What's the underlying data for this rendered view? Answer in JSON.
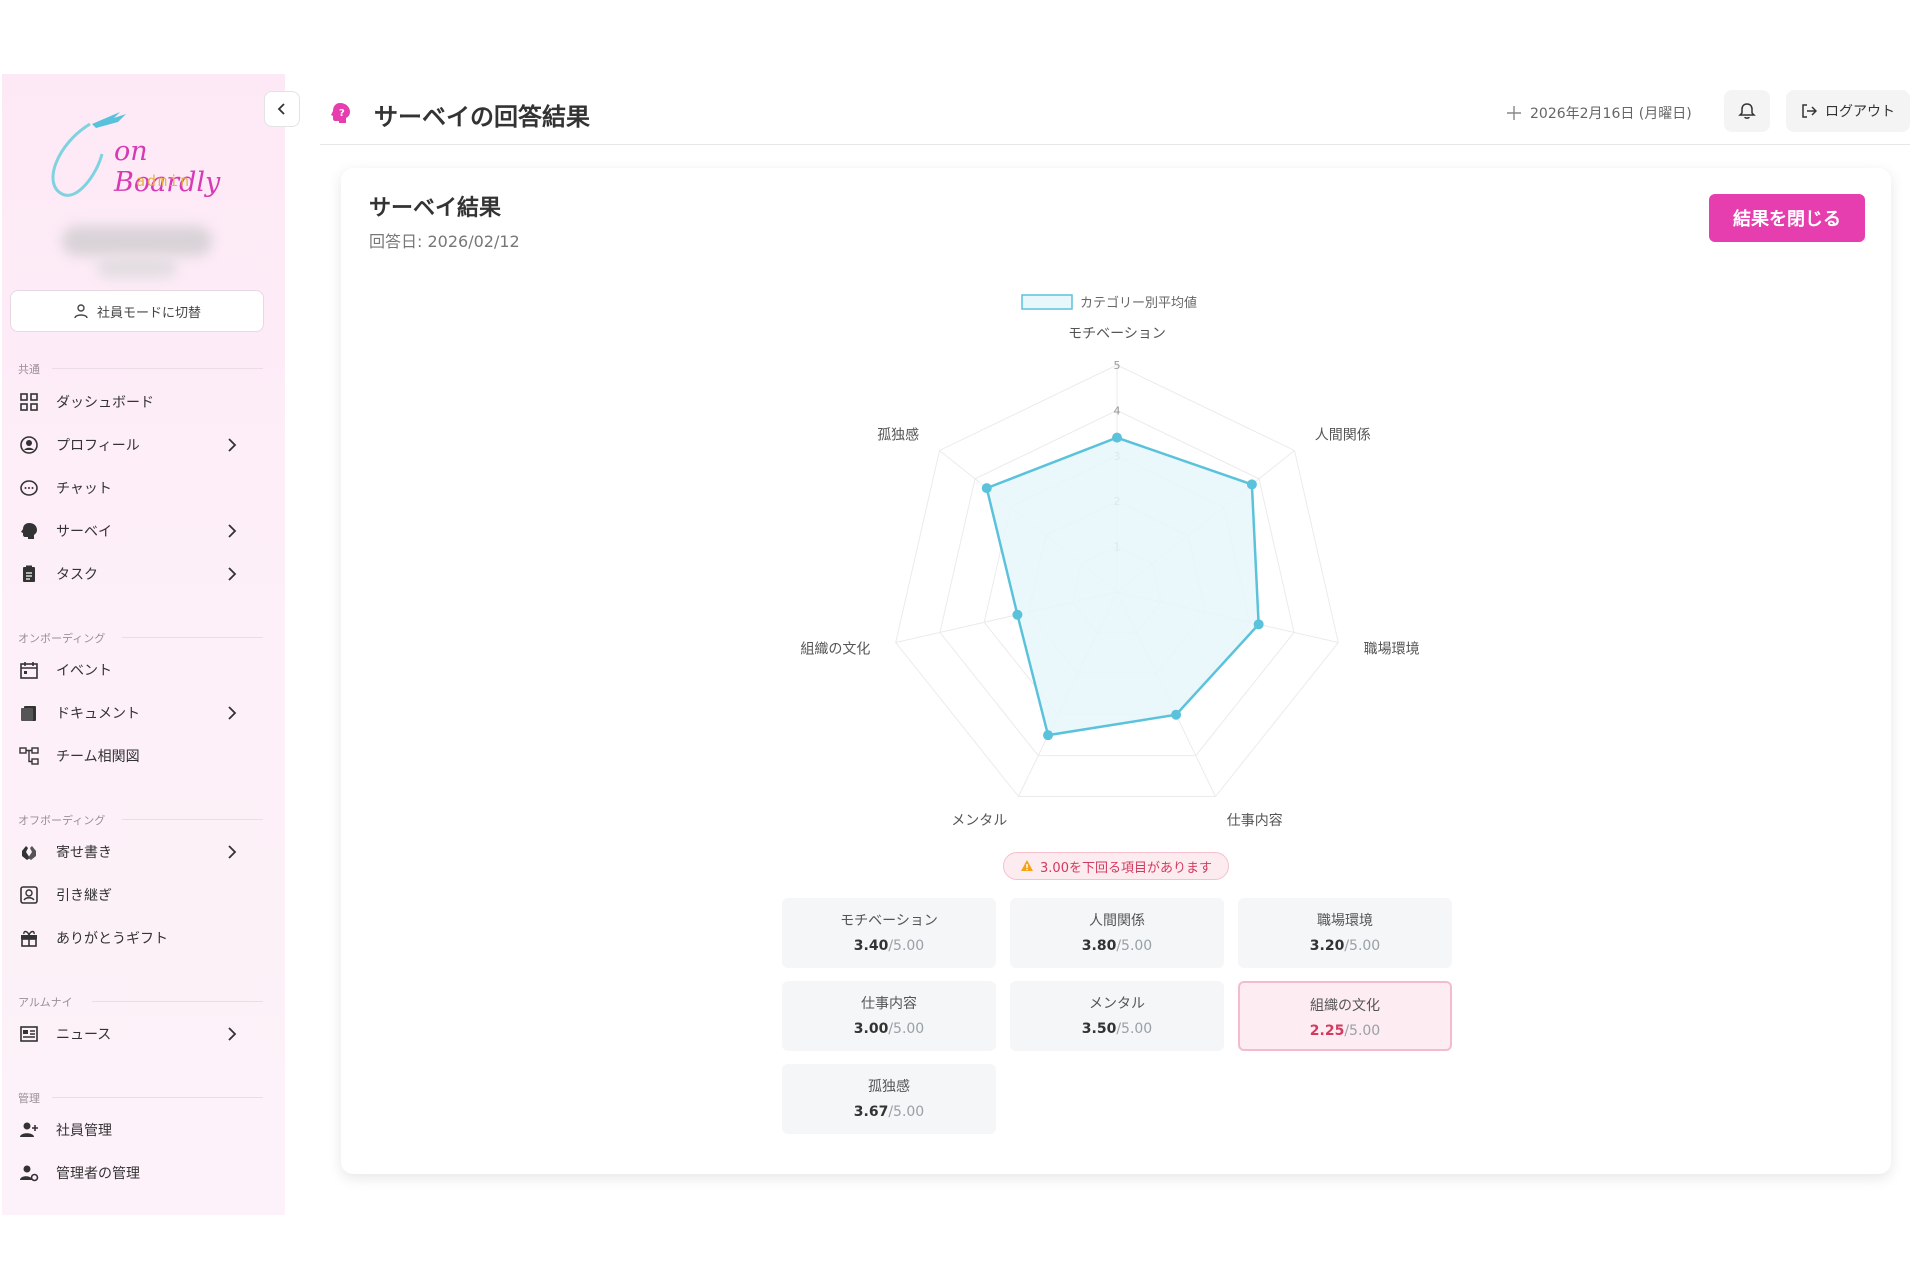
{
  "app": {
    "logo_text": "on Boardly",
    "logo_sub": "admin"
  },
  "sidebar": {
    "mode_switch": "社員モードに切替",
    "sections": [
      {
        "label": "共通",
        "items": [
          "ダッシュボード",
          "プロフィール",
          "チャット",
          "サーベイ",
          "タスク"
        ]
      },
      {
        "label": "オンボーディング",
        "items": [
          "イベント",
          "ドキュメント",
          "チーム相関図"
        ]
      },
      {
        "label": "オフボーディング",
        "items": [
          "寄せ書き",
          "引き継ぎ",
          "ありがとうギフト"
        ]
      },
      {
        "label": "アルムナイ",
        "items": [
          "ニュース"
        ]
      },
      {
        "label": "管理",
        "items": [
          "社員管理",
          "管理者の管理"
        ]
      }
    ]
  },
  "header": {
    "title": "サーベイの回答結果",
    "date": "2026年2月16日 (月曜日)",
    "logout": "ログアウト"
  },
  "card": {
    "title": "サーベイ結果",
    "answered_date": "回答日: 2026/02/12",
    "close_button": "結果を閉じる",
    "warning": "3.00を下回る項目があります",
    "categories": [
      {
        "name": "モチベーション",
        "score": "3.40",
        "max": "/5.00",
        "low": false
      },
      {
        "name": "人間関係",
        "score": "3.80",
        "max": "/5.00",
        "low": false
      },
      {
        "name": "職場環境",
        "score": "3.20",
        "max": "/5.00",
        "low": false
      },
      {
        "name": "仕事内容",
        "score": "3.00",
        "max": "/5.00",
        "low": false
      },
      {
        "name": "メンタル",
        "score": "3.50",
        "max": "/5.00",
        "low": false
      },
      {
        "name": "組織の文化",
        "score": "2.25",
        "max": "/5.00",
        "low": true
      },
      {
        "name": "孤独感",
        "score": "3.67",
        "max": "/5.00",
        "low": false
      }
    ]
  },
  "chart_data": {
    "type": "radar",
    "legend": "カテゴリー別平均値",
    "axes": [
      "モチベーション",
      "人間関係",
      "職場環境",
      "仕事内容",
      "メンタル",
      "組織の文化",
      "孤独感"
    ],
    "values": [
      3.4,
      3.8,
      3.2,
      3.0,
      3.5,
      2.25,
      3.67
    ],
    "rmax": 5,
    "ticks": [
      "1",
      "2",
      "3",
      "4",
      "5"
    ],
    "color": "#5bc2dc",
    "fill": "#e8f7fa"
  },
  "colors": {
    "accent": "#e63eae",
    "warning": "#d23a5f"
  }
}
